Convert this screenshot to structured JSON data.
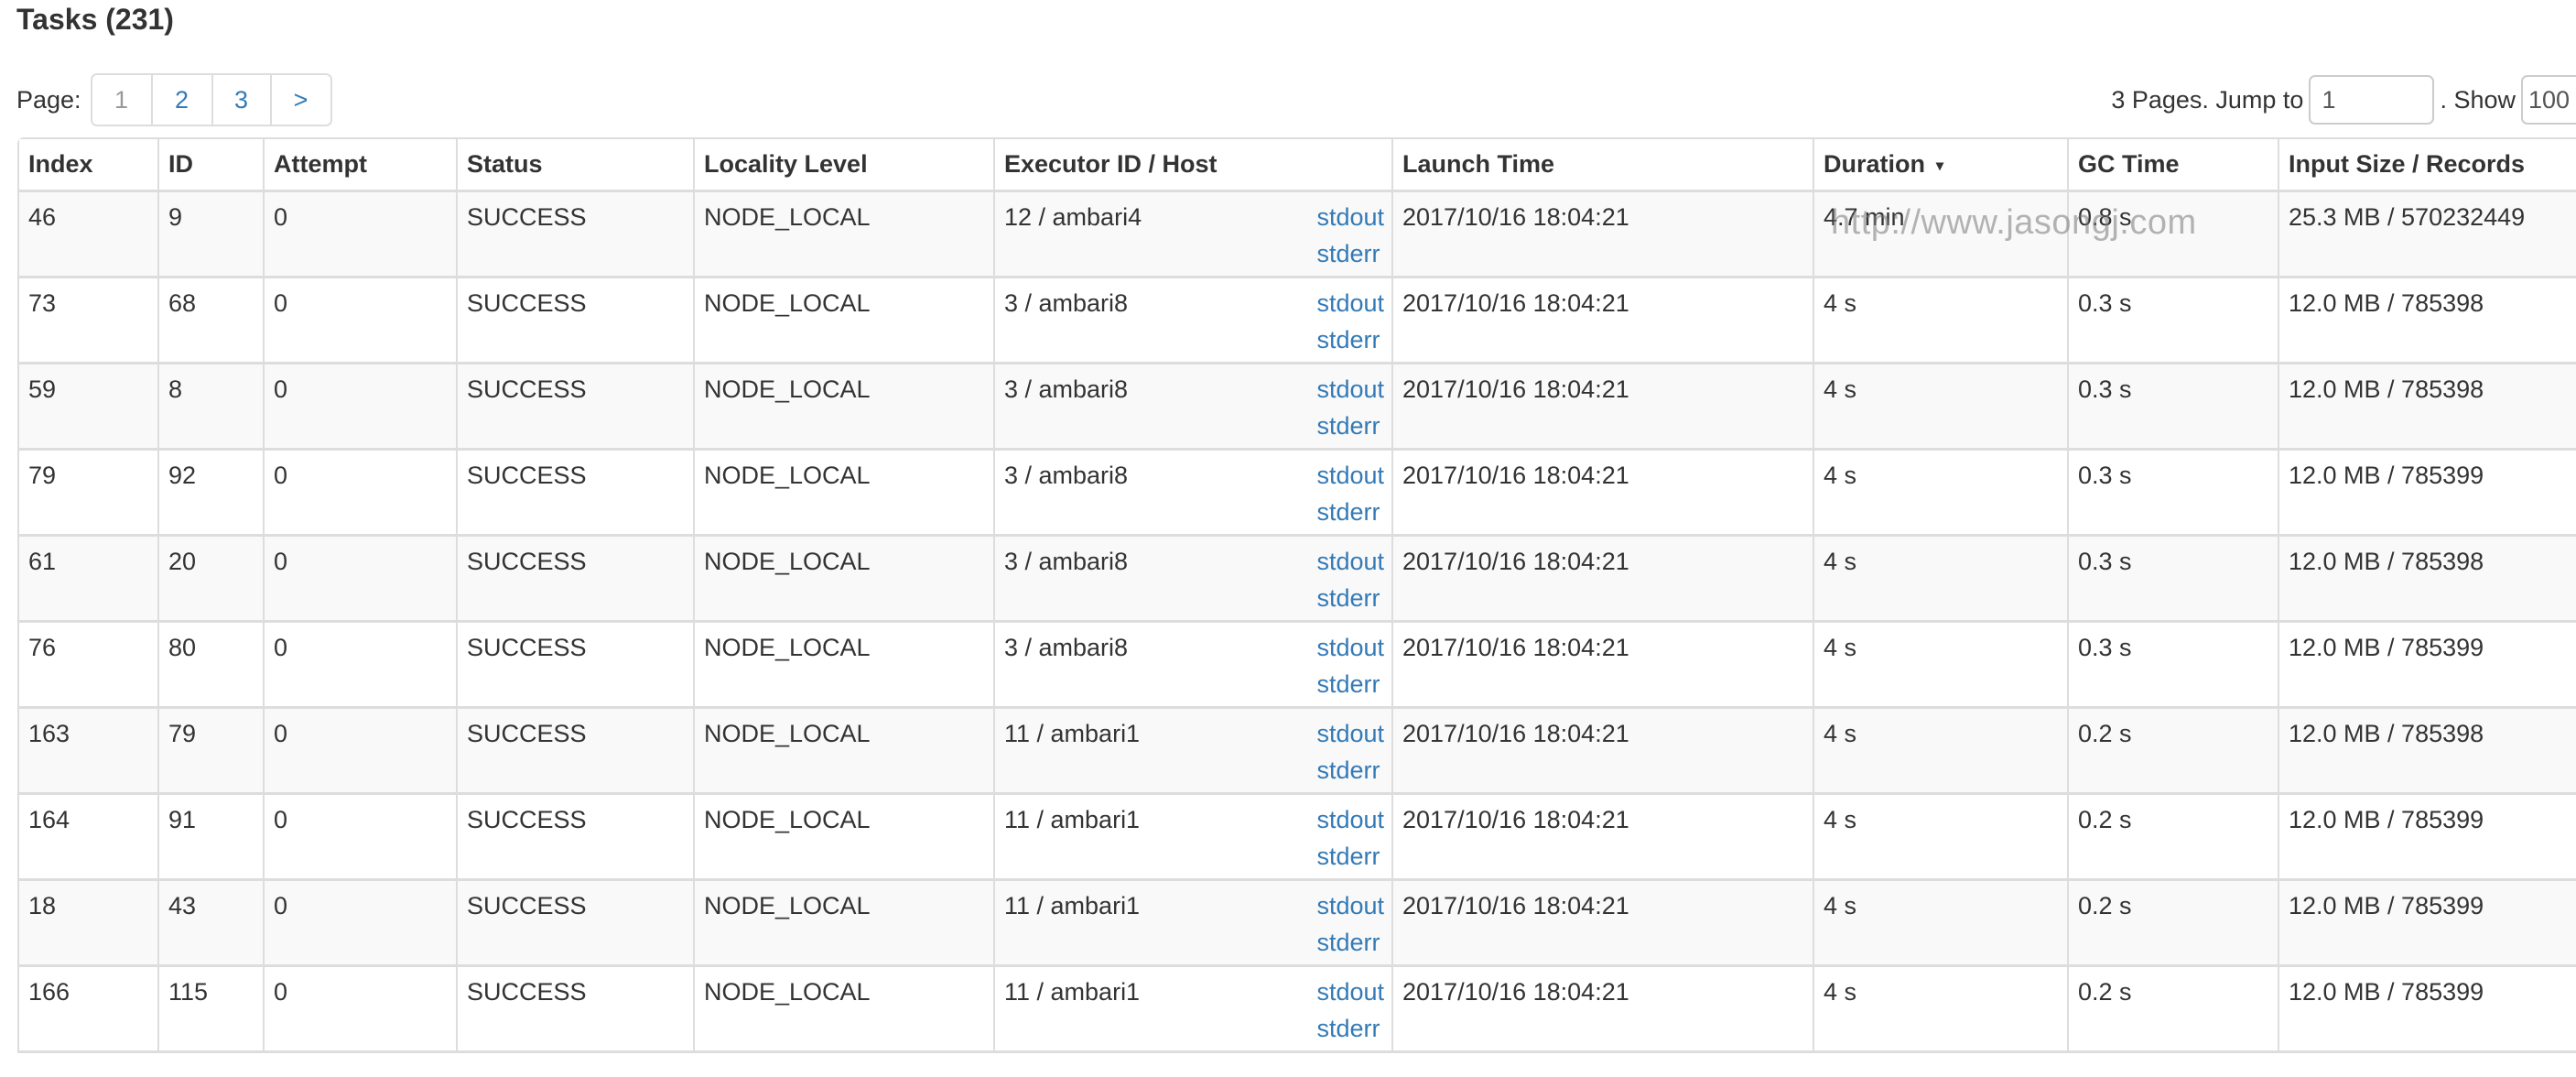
{
  "page": {
    "title": "Tasks (231)"
  },
  "pagination": {
    "label": "Page:",
    "pages": [
      "1",
      "2",
      "3"
    ],
    "active_page": "1",
    "next_label": ">",
    "summary": "3 Pages. Jump to",
    "jump_value": "1",
    "show_label": ". Show",
    "show_value": "100"
  },
  "table": {
    "columns": [
      "Index",
      "ID",
      "Attempt",
      "Status",
      "Locality Level",
      "Executor ID / Host",
      "Launch Time",
      "Duration",
      "GC Time",
      "Input Size / Records"
    ],
    "sorted_column": "Duration",
    "sort_direction_icon": "▾",
    "log_links": [
      "stdout",
      "stderr"
    ],
    "rows": [
      {
        "index": "46",
        "id": "9",
        "attempt": "0",
        "status": "SUCCESS",
        "locality": "NODE_LOCAL",
        "executor": "12 / ambari4",
        "launch": "2017/10/16 18:04:21",
        "duration": "4.7 min",
        "gc": "0.8 s",
        "input": "25.3 MB / 570232449"
      },
      {
        "index": "73",
        "id": "68",
        "attempt": "0",
        "status": "SUCCESS",
        "locality": "NODE_LOCAL",
        "executor": "3 / ambari8",
        "launch": "2017/10/16 18:04:21",
        "duration": "4 s",
        "gc": "0.3 s",
        "input": "12.0 MB / 785398"
      },
      {
        "index": "59",
        "id": "8",
        "attempt": "0",
        "status": "SUCCESS",
        "locality": "NODE_LOCAL",
        "executor": "3 / ambari8",
        "launch": "2017/10/16 18:04:21",
        "duration": "4 s",
        "gc": "0.3 s",
        "input": "12.0 MB / 785398"
      },
      {
        "index": "79",
        "id": "92",
        "attempt": "0",
        "status": "SUCCESS",
        "locality": "NODE_LOCAL",
        "executor": "3 / ambari8",
        "launch": "2017/10/16 18:04:21",
        "duration": "4 s",
        "gc": "0.3 s",
        "input": "12.0 MB / 785399"
      },
      {
        "index": "61",
        "id": "20",
        "attempt": "0",
        "status": "SUCCESS",
        "locality": "NODE_LOCAL",
        "executor": "3 / ambari8",
        "launch": "2017/10/16 18:04:21",
        "duration": "4 s",
        "gc": "0.3 s",
        "input": "12.0 MB / 785398"
      },
      {
        "index": "76",
        "id": "80",
        "attempt": "0",
        "status": "SUCCESS",
        "locality": "NODE_LOCAL",
        "executor": "3 / ambari8",
        "launch": "2017/10/16 18:04:21",
        "duration": "4 s",
        "gc": "0.3 s",
        "input": "12.0 MB / 785399"
      },
      {
        "index": "163",
        "id": "79",
        "attempt": "0",
        "status": "SUCCESS",
        "locality": "NODE_LOCAL",
        "executor": "11 / ambari1",
        "launch": "2017/10/16 18:04:21",
        "duration": "4 s",
        "gc": "0.2 s",
        "input": "12.0 MB / 785398"
      },
      {
        "index": "164",
        "id": "91",
        "attempt": "0",
        "status": "SUCCESS",
        "locality": "NODE_LOCAL",
        "executor": "11 / ambari1",
        "launch": "2017/10/16 18:04:21",
        "duration": "4 s",
        "gc": "0.2 s",
        "input": "12.0 MB / 785399"
      },
      {
        "index": "18",
        "id": "43",
        "attempt": "0",
        "status": "SUCCESS",
        "locality": "NODE_LOCAL",
        "executor": "11 / ambari1",
        "launch": "2017/10/16 18:04:21",
        "duration": "4 s",
        "gc": "0.2 s",
        "input": "12.0 MB / 785399"
      },
      {
        "index": "166",
        "id": "115",
        "attempt": "0",
        "status": "SUCCESS",
        "locality": "NODE_LOCAL",
        "executor": "11 / ambari1",
        "launch": "2017/10/16 18:04:21",
        "duration": "4 s",
        "gc": "0.2 s",
        "input": "12.0 MB / 785399"
      }
    ]
  },
  "watermark": "http://www.jasongj.com",
  "colors": {
    "link": "#337ab7",
    "text": "#333333",
    "border": "#dddddd",
    "stripe": "#f9f9f9",
    "inactive_page": "#999999"
  }
}
